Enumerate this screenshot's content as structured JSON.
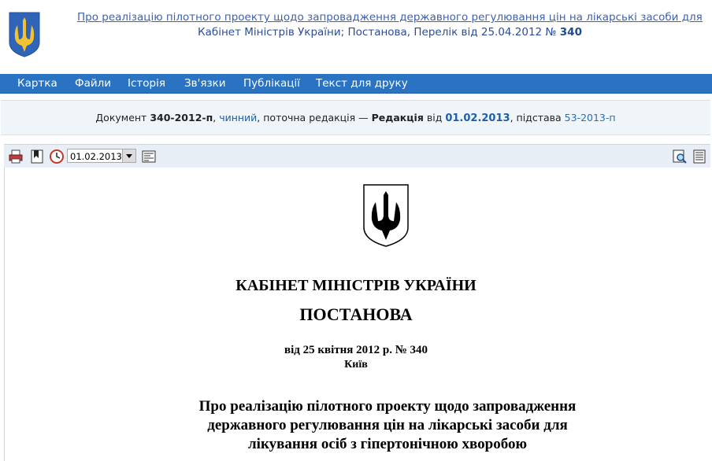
{
  "header": {
    "title_link": "Про реалізацію пілотного проекту щодо запровадження державного регулювання цін на лікарські засоби для [...]",
    "subtitle_prefix": "Кабінет Міністрів України; Постанова, Перелік від 25.04.2012 № ",
    "subtitle_number": "340"
  },
  "nav": {
    "items": [
      "Картка",
      "Файли",
      "Історія",
      "Зв'язки",
      "Публікації",
      "Текст для друку"
    ]
  },
  "infobar": {
    "doc_label": "Документ",
    "doc_id": "340-2012-п",
    "status": "чинний",
    "current_label": "поточна редакція —",
    "edition_label": "Редакція",
    "from_label": "від",
    "edition_date": "01.02.2013",
    "basis_label": "підстава",
    "basis_link": "53-2013-п"
  },
  "toolbar": {
    "date_value": "01.02.2013",
    "icons": [
      "print-icon",
      "bookmark-icon",
      "history-clock-icon",
      "compare-icon",
      "search-in-text-icon",
      "contents-icon"
    ]
  },
  "document": {
    "cabinet": "КАБІНЕТ МІНІСТРІВ УКРАЇНИ",
    "type": "ПОСТАНОВА",
    "date_line": "від 25 квітня 2012 р. № 340",
    "city": "Київ",
    "title_lines": [
      "Про реалізацію пілотного проекту щодо запровадження",
      "державного регулювання цін на лікарські засоби для",
      "лікування осіб з гіпертонічною хворобою"
    ]
  },
  "colors": {
    "nav_bg": "#2a73c3",
    "link": "#3c62b3",
    "infobar_bg": "#f0f5fa",
    "coat_blue": "#2f64b7",
    "coat_gold": "#f2c230"
  }
}
